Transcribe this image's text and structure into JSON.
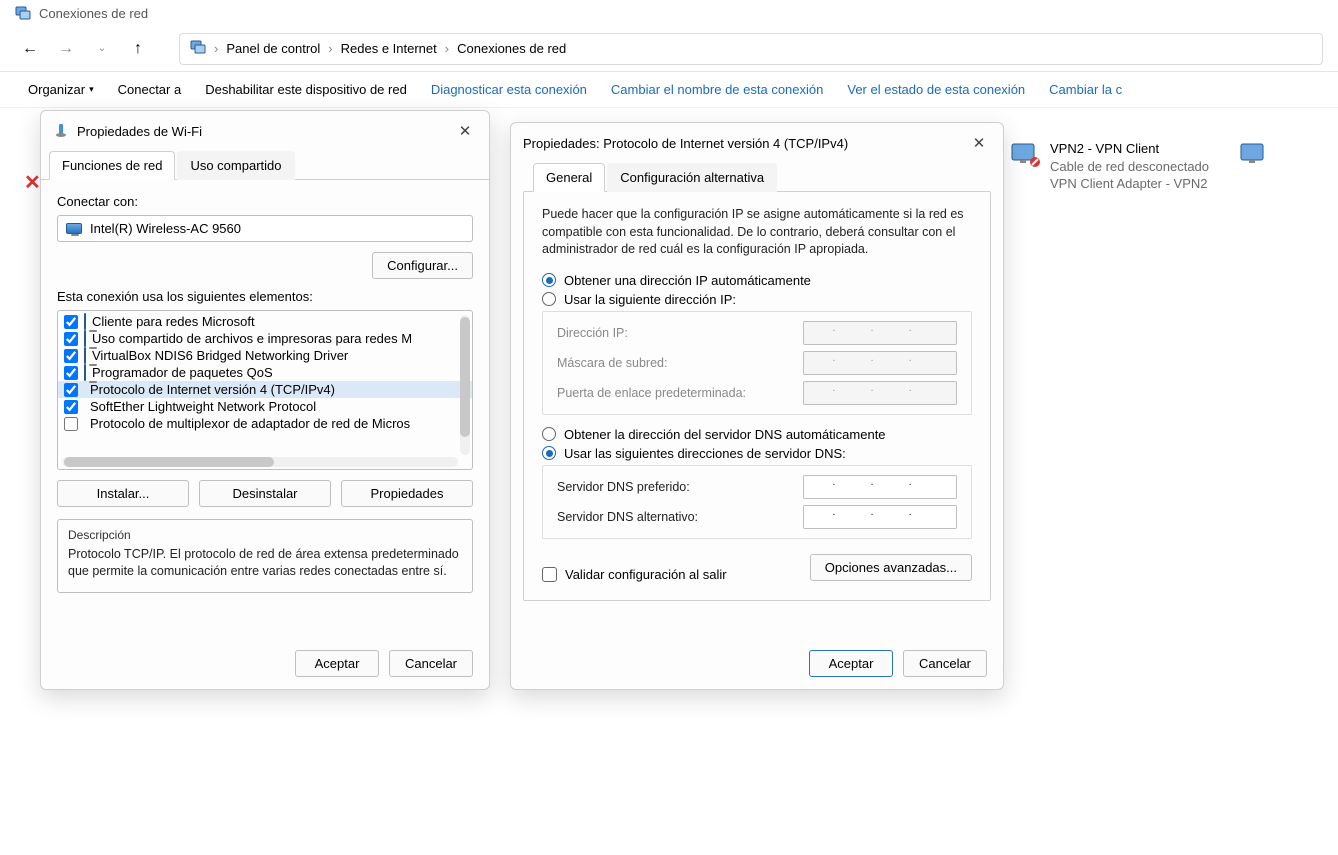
{
  "window": {
    "title": "Conexiones de red"
  },
  "breadcrumbs": {
    "root": "Panel de control",
    "mid": "Redes e Internet",
    "leaf": "Conexiones de red"
  },
  "toolbar": {
    "organizar": "Organizar",
    "conectar": "Conectar a",
    "deshabilitar": "Deshabilitar este dispositivo de red",
    "diagnosticar": "Diagnosticar esta conexión",
    "cambiar_nombre": "Cambiar el nombre de esta conexión",
    "ver_estado": "Ver el estado de esta conexión",
    "cambiar_la": "Cambiar la c"
  },
  "connections": {
    "vpn2": {
      "name": "VPN2 - VPN Client",
      "status": "Cable de red desconectado",
      "adapter": "VPN Client Adapter - VPN2"
    }
  },
  "wifi": {
    "title": "Propiedades de Wi-Fi",
    "tabs": {
      "funciones": "Funciones de red",
      "uso": "Uso compartido"
    },
    "conectar_label": "Conectar con:",
    "adapter": "Intel(R) Wireless-AC 9560",
    "configurar": "Configurar...",
    "elementos_label": "Esta conexión usa los siguientes elementos:",
    "items": [
      {
        "checked": true,
        "text": "Cliente para redes Microsoft"
      },
      {
        "checked": true,
        "text": "Uso compartido de archivos e impresoras para redes M"
      },
      {
        "checked": true,
        "text": "VirtualBox NDIS6 Bridged Networking Driver"
      },
      {
        "checked": true,
        "text": "Programador de paquetes QoS"
      },
      {
        "checked": true,
        "text": "Protocolo de Internet versión 4 (TCP/IPv4)",
        "selected": true
      },
      {
        "checked": true,
        "text": "SoftEther Lightweight Network Protocol"
      },
      {
        "checked": false,
        "text": "Protocolo de multiplexor de adaptador de red de Micros"
      }
    ],
    "instalar": "Instalar...",
    "desinstalar": "Desinstalar",
    "propiedades": "Propiedades",
    "desc_label": "Descripción",
    "desc_text": "Protocolo TCP/IP. El protocolo de red de área extensa predeterminado que permite la comunicación entre varias redes conectadas entre sí.",
    "aceptar": "Aceptar",
    "cancelar": "Cancelar"
  },
  "ipv4": {
    "title": "Propiedades: Protocolo de Internet versión 4 (TCP/IPv4)",
    "tabs": {
      "general": "General",
      "alt": "Configuración alternativa"
    },
    "intro": "Puede hacer que la configuración IP se asigne automáticamente si la red es compatible con esta funcionalidad. De lo contrario, deberá consultar con el administrador de red cuál es la configuración IP apropiada.",
    "radio_ip_auto": "Obtener una dirección IP automáticamente",
    "radio_ip_manual": "Usar la siguiente dirección IP:",
    "ip_label": "Dirección IP:",
    "mask_label": "Máscara de subred:",
    "gateway_label": "Puerta de enlace predeterminada:",
    "radio_dns_auto": "Obtener la dirección del servidor DNS automáticamente",
    "radio_dns_manual": "Usar las siguientes direcciones de servidor DNS:",
    "dns_pref_label": "Servidor DNS preferido:",
    "dns_alt_label": "Servidor DNS alternativo:",
    "validate": "Validar configuración al salir",
    "advanced": "Opciones avanzadas...",
    "aceptar": "Aceptar",
    "cancelar": "Cancelar",
    "ip_dots": ".   .   ."
  }
}
